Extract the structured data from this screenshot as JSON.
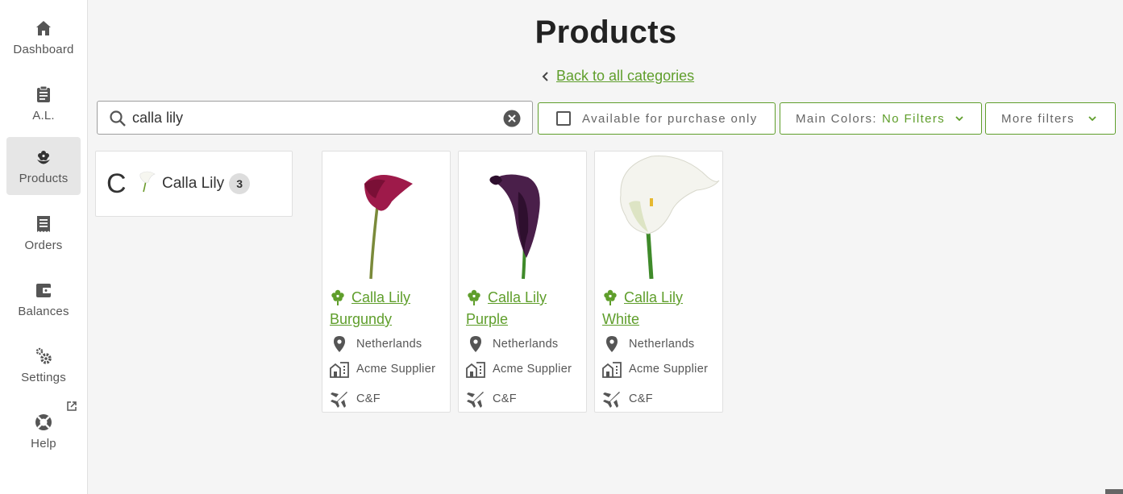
{
  "sidebar": {
    "items": [
      {
        "label": "Dashboard",
        "icon": "home-icon"
      },
      {
        "label": "A.L.",
        "icon": "clipboard-icon"
      },
      {
        "label": "Products",
        "icon": "flower-icon",
        "active": true
      },
      {
        "label": "Orders",
        "icon": "receipt-icon"
      },
      {
        "label": "Balances",
        "icon": "wallet-icon"
      },
      {
        "label": "Settings",
        "icon": "gears-icon"
      },
      {
        "label": "Help",
        "icon": "lifebuoy-icon"
      }
    ]
  },
  "header": {
    "title": "Products",
    "back_link": "Back to all categories"
  },
  "search": {
    "value": "calla lily",
    "placeholder": ""
  },
  "filters": {
    "available_label": "Available for purchase only",
    "available_checked": false,
    "colors_label": "Main Colors:",
    "colors_value": "No Filters",
    "more_label": "More filters"
  },
  "category": {
    "letter": "C",
    "name": "Calla Lily",
    "count": "3"
  },
  "products": [
    {
      "name": "Calla Lily Burgundy",
      "origin": "Netherlands",
      "supplier": "Acme Supplier",
      "terms": "C&F",
      "color": "#9e1a4a"
    },
    {
      "name": "Calla Lily Purple",
      "origin": "Netherlands",
      "supplier": "Acme Supplier",
      "terms": "C&F",
      "color": "#4a1f4a"
    },
    {
      "name": "Calla Lily White",
      "origin": "Netherlands",
      "supplier": "Acme Supplier",
      "terms": "C&F",
      "color": "#f4f4ee"
    }
  ],
  "colors": {
    "accent": "#5f9e2b",
    "nav_active_bg": "#e6e6e6",
    "icon_gray": "#555555"
  }
}
